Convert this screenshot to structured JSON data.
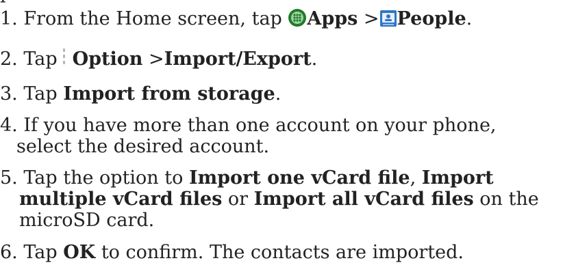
{
  "cut_text": "p",
  "steps": [
    {
      "num": "1.",
      "before": " From the Home screen, tap ",
      "apps_icon": "apps-grid-icon",
      "apps_label": "Apps",
      "sep": " >",
      "people_icon": "people-contacts-icon",
      "people_label": "People",
      "end": "."
    },
    {
      "num": "2.",
      "before": " Tap",
      "option_icon": "option-menu-icon",
      "option_label": "Option",
      "sep": " >",
      "target": "Import/Export",
      "end": "."
    },
    {
      "num": "3.",
      "before": " Tap ",
      "target": "Import from storage",
      "end": "."
    },
    {
      "num": "4.",
      "line1": " If you have more than one account on your phone,",
      "line2": "select the desired account."
    },
    {
      "num": "5.",
      "line1_before": " Tap the option to ",
      "option1": "Import one vCard file",
      "line1_mid": ", ",
      "option2_part1": "Import",
      "option2_part2": "multiple vCard files",
      "line2_mid": " or ",
      "option3": "Import all vCard files",
      "line2_after": " on the",
      "line3": "microSD card."
    },
    {
      "num": "6.",
      "before": " Tap ",
      "target": "OK",
      "after": " to confirm. The contacts are imported."
    }
  ],
  "colors": {
    "text": "#222222",
    "apps_icon_bg": "#1f7d27",
    "apps_icon_dots": "#ffffff",
    "people_icon_bg": "#2d77c7",
    "people_icon_card": "#e8eef8",
    "option_dots": "#b7b7b7"
  }
}
